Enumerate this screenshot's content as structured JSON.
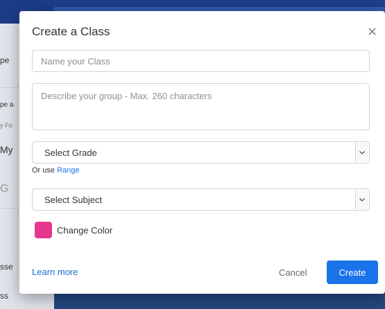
{
  "modal": {
    "title": "Create a Class",
    "close_symbol": "×",
    "name_placeholder": "Name your Class",
    "description_placeholder": "Describe your group - Max. 260 characters",
    "grade_select": {
      "selected": "Select Grade"
    },
    "range": {
      "prefix": "Or use",
      "link_label": "Range"
    },
    "subject_select": {
      "selected": "Select Subject"
    },
    "color": {
      "label": "Change Color",
      "swatch_hex": "#e8368f"
    },
    "footer": {
      "learn_more": "Learn more",
      "cancel": "Cancel",
      "create": "Create"
    }
  },
  "background": {
    "left_items": [
      "pe",
      "pe a",
      "y Fo",
      "My",
      "G",
      "sse",
      "ss"
    ]
  },
  "colors": {
    "accent": "#1a73e8",
    "link": "#1a6fd1"
  },
  "icons": [
    "close-icon",
    "chevron-down-icon"
  ]
}
